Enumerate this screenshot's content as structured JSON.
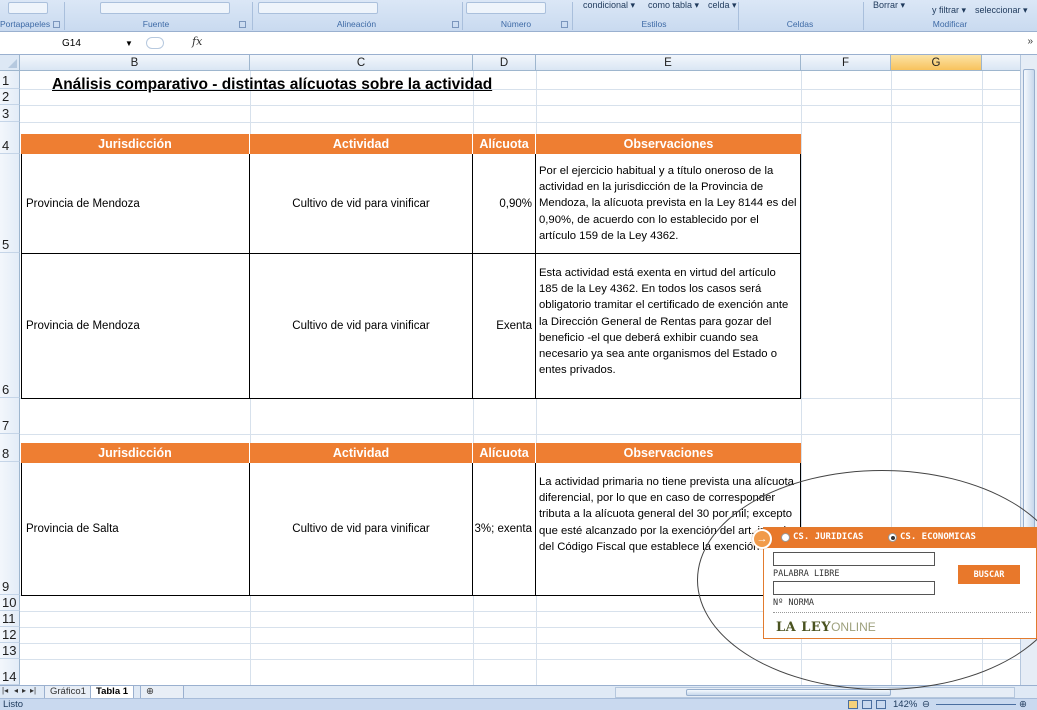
{
  "ribbon": {
    "groups": [
      "Portapapeles",
      "Fuente",
      "Alineación",
      "Número",
      "Estilos",
      "Celdas",
      "Modificar"
    ],
    "estilos_buttons": [
      "condicional ▾",
      "como tabla ▾",
      "celda ▾"
    ],
    "borrar": "Borrar ▾",
    "filtrar": "y filtrar ▾",
    "seleccionar": "seleccionar ▾"
  },
  "formula_bar": {
    "cell_ref": "G14",
    "fx": "fx",
    "value": ""
  },
  "columns": [
    "B",
    "C",
    "D",
    "E",
    "F",
    "G"
  ],
  "selected_column": "G",
  "rows": [
    "1",
    "2",
    "3",
    "4",
    "5",
    "6",
    "7",
    "8",
    "9",
    "10",
    "11",
    "12",
    "13",
    "14"
  ],
  "title": "Análisis comparativo - distintas alícuotas sobre la actividad",
  "tables": [
    {
      "headers": [
        "Jurisdicción",
        "Actividad",
        "Alícuota",
        "Observaciones"
      ],
      "rows": [
        {
          "jurisdiccion": "Provincia de Mendoza",
          "actividad": "Cultivo de vid para vinificar",
          "alicuota": "0,90%",
          "observaciones": "Por el ejercicio habitual y a título oneroso de la actividad en la jurisdicción de la Provincia de Mendoza, la alícuota prevista en la Ley 8144 es del 0,90%, de acuerdo con lo establecido por el artículo 159 de la Ley 4362."
        },
        {
          "jurisdiccion": "Provincia de Mendoza",
          "actividad": "Cultivo de vid para vinificar",
          "alicuota": "Exenta",
          "observaciones": "Esta actividad está exenta en virtud del artículo 185 de la Ley 4362. En todos los casos será obligatorio tramitar el certificado de exención ante la Dirección General de Rentas para gozar del beneficio -el que deberá exhibir cuando sea necesario ya sea ante organismos del Estado o entes privados."
        }
      ]
    },
    {
      "headers": [
        "Jurisdicción",
        "Actividad",
        "Alícuota",
        "Observaciones"
      ],
      "rows": [
        {
          "jurisdiccion": "Provincia de Salta",
          "actividad": "Cultivo de vid para vinificar",
          "alicuota": "3%; exenta",
          "observaciones": "La actividad primaria no tiene prevista una alícuota diferencial, por lo que en caso de corresponder tributa a la alícuota general del 30 por mil; excepto que esté alcanzado por la exención del art. inc. x) del Código Fiscal que establece la exención"
        }
      ]
    }
  ],
  "sheet_tabs": [
    "Gráfico1",
    "Tabla 1"
  ],
  "active_tab": "Tabla 1",
  "status": {
    "mode": "Listo",
    "zoom": "142%"
  },
  "laley": {
    "radio_1": "CS. JURIDICAS",
    "radio_2": "CS. ECONOMICAS",
    "selected": "CS. ECONOMICAS",
    "label_1": "PALABRA LIBRE",
    "label_2": "Nº NORMA",
    "button": "BUSCAR",
    "logo_bold": "LA LEY",
    "logo_light": "ONLINE",
    "accent_color": "#e8782b"
  },
  "colors": {
    "header_orange": "#ee7e32",
    "selected_col": "#f8c25d"
  }
}
